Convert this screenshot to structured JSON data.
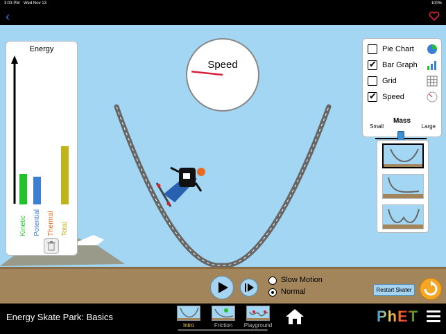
{
  "status": {
    "time": "3:03 PM",
    "date": "Wed Nov 13",
    "battery": "100%"
  },
  "energy_panel": {
    "title": "Energy",
    "bars": [
      {
        "name": "Kinetic",
        "value": 0.22,
        "color": "#22c22a"
      },
      {
        "name": "Potential",
        "value": 0.2,
        "color": "#3a7fd3"
      },
      {
        "name": "Thermal",
        "value": 0.0,
        "color": "#e06a1f"
      },
      {
        "name": "Total",
        "value": 0.42,
        "color": "#c0b419"
      }
    ]
  },
  "speedometer": {
    "label": "Speed",
    "needle_fraction": 0.08
  },
  "controls": {
    "pie_chart": {
      "label": "Pie Chart",
      "checked": false
    },
    "bar_graph": {
      "label": "Bar Graph",
      "checked": true
    },
    "grid": {
      "label": "Grid",
      "checked": false
    },
    "speed": {
      "label": "Speed",
      "checked": true
    },
    "mass": {
      "title": "Mass",
      "min_label": "Small",
      "max_label": "Large",
      "value": 0.5
    }
  },
  "playback": {
    "slow_motion": "Slow Motion",
    "normal": "Normal",
    "selected": "normal",
    "restart": "Restart Skater"
  },
  "nav": {
    "title": "Energy Skate Park: Basics",
    "screens": [
      {
        "label": "Intro",
        "active": true
      },
      {
        "label": "Friction",
        "active": false
      },
      {
        "label": "Playground",
        "active": false
      }
    ],
    "logo": "PhET"
  }
}
